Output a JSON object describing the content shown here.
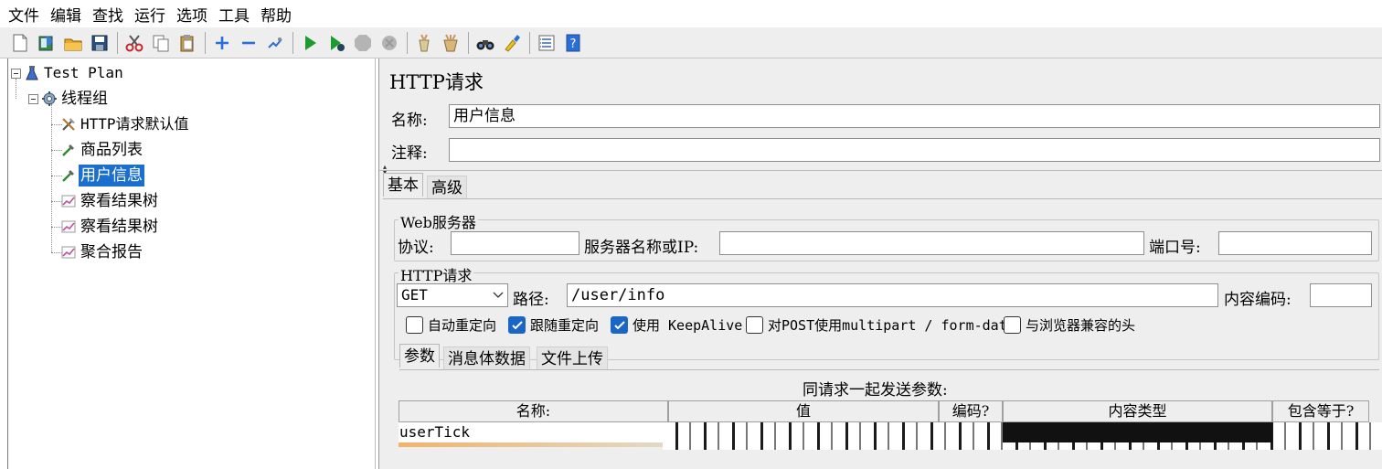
{
  "menu": {
    "items": [
      "文件",
      "编辑",
      "查找",
      "运行",
      "选项",
      "工具",
      "帮助"
    ]
  },
  "toolbar": {
    "buttons": [
      {
        "icon": "new-document-icon",
        "tooltip": ""
      },
      {
        "icon": "templates-icon",
        "tooltip": ""
      },
      {
        "icon": "open-folder-icon",
        "tooltip": ""
      },
      {
        "icon": "save-icon",
        "tooltip": ""
      },
      {
        "icon": "cut-icon",
        "tooltip": ""
      },
      {
        "icon": "copy-icon",
        "tooltip": ""
      },
      {
        "icon": "paste-icon",
        "tooltip": ""
      },
      {
        "icon": "expand-icon",
        "tooltip": ""
      },
      {
        "icon": "collapse-icon",
        "tooltip": ""
      },
      {
        "icon": "toggle-icon",
        "tooltip": ""
      },
      {
        "icon": "start-icon",
        "tooltip": ""
      },
      {
        "icon": "start-no-pauses-icon",
        "tooltip": ""
      },
      {
        "icon": "stop-icon",
        "tooltip": ""
      },
      {
        "icon": "shutdown-icon",
        "tooltip": ""
      },
      {
        "icon": "clear-icon",
        "tooltip": ""
      },
      {
        "icon": "clear-all-icon",
        "tooltip": ""
      },
      {
        "icon": "search-binoculars-icon",
        "tooltip": ""
      },
      {
        "icon": "reset-search-icon",
        "tooltip": ""
      },
      {
        "icon": "function-helper-icon",
        "tooltip": ""
      },
      {
        "icon": "help-icon",
        "tooltip": ""
      }
    ]
  },
  "tree": {
    "root": {
      "label": "Test Plan",
      "icon": "test-plan-icon"
    },
    "thread_group": {
      "label": "线程组",
      "icon": "gear-icon"
    },
    "children": [
      {
        "label": "HTTP请求默认值",
        "icon": "config-tools-icon",
        "selected": false
      },
      {
        "label": "商品列表",
        "icon": "sampler-pipette-icon",
        "selected": false
      },
      {
        "label": "用户信息",
        "icon": "sampler-pipette-icon",
        "selected": true
      },
      {
        "label": "察看结果树",
        "icon": "listener-graph-icon",
        "selected": false
      },
      {
        "label": "察看结果树",
        "icon": "listener-graph-icon",
        "selected": false
      },
      {
        "label": "聚合报告",
        "icon": "listener-graph-icon",
        "selected": false
      }
    ]
  },
  "panel": {
    "title": "HTTP请求",
    "name_label": "名称:",
    "name_value": "用户信息",
    "comment_label": "注释:",
    "comment_value": "",
    "tabs": [
      "基本",
      "高级"
    ],
    "web_server": {
      "title": "Web服务器",
      "protocol_label": "协议:",
      "protocol_value": "",
      "server_label": "服务器名称或IP:",
      "server_value": "",
      "port_label": "端口号:",
      "port_value": ""
    },
    "http_request": {
      "title": "HTTP请求",
      "method": "GET",
      "path_label": "路径:",
      "path_value": "/user/info",
      "encoding_label": "内容编码:",
      "encoding_value": ""
    },
    "options": [
      {
        "label": "自动重定向",
        "checked": false
      },
      {
        "label": "跟随重定向",
        "checked": true
      },
      {
        "label": "使用 KeepAlive",
        "checked": true
      },
      {
        "label": "对POST使用multipart / form-data",
        "checked": false
      },
      {
        "label": "与浏览器兼容的头",
        "checked": false
      }
    ],
    "sub_tabs": [
      "参数",
      "消息体数据",
      "文件上传"
    ],
    "params": {
      "caption": "同请求一起发送参数:",
      "columns": [
        "名称:",
        "值",
        "编码?",
        "内容类型",
        "包含等于?"
      ],
      "rows": [
        {
          "name": "userTick"
        }
      ]
    }
  },
  "colors": {
    "selection": "#1a6fcf",
    "checkbox_checked": "#1a66c4",
    "panel_bg": "#eeeeee",
    "run_green": "#1e9b2e"
  }
}
